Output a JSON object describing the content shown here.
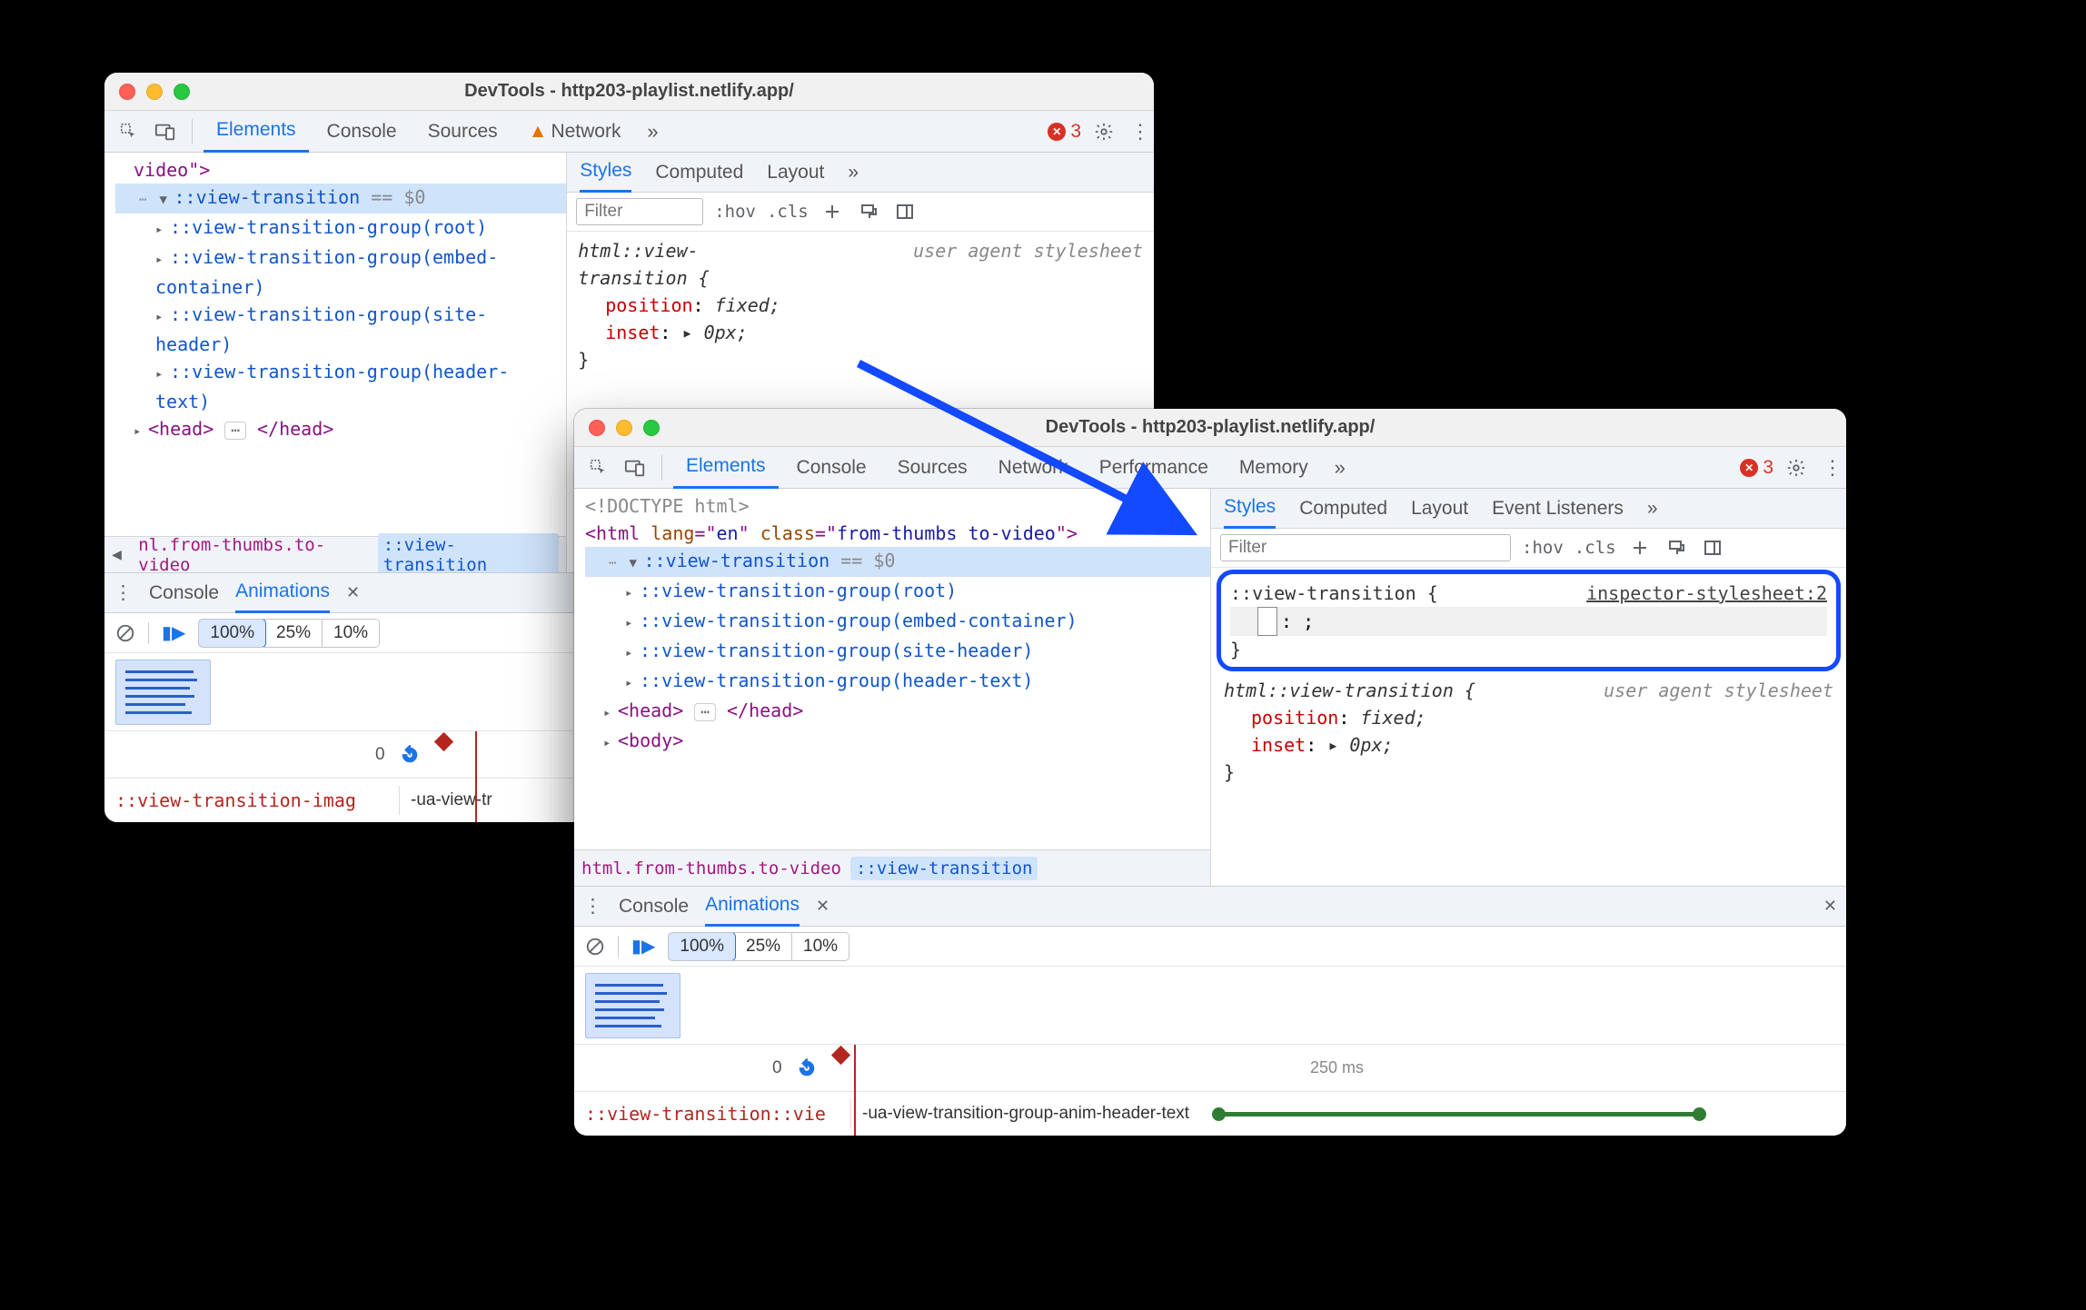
{
  "window1": {
    "title": "DevTools - http203-playlist.netlify.app/",
    "main_tabs": [
      "Elements",
      "Console",
      "Sources",
      "Network"
    ],
    "active_main_tab": "Elements",
    "warning_on": "Network",
    "error_count": "3",
    "dom": {
      "line0_prefix": "video\">",
      "selected": "::view-transition",
      "eqvar": "== $0",
      "groups": [
        "::view-transition-group(root)",
        "::view-transition-group(embed-container)",
        "::view-transition-group(site-header)",
        "::view-transition-group(header-text)"
      ],
      "head_open": "<head>",
      "head_close": "</head>"
    },
    "crumbs": {
      "left": "nl.from-thumbs.to-video",
      "selected": "::view-transition"
    },
    "styles": {
      "tabs": [
        "Styles",
        "Computed",
        "Layout"
      ],
      "active": "Styles",
      "filter_placeholder": "Filter",
      "hov": ":hov",
      "cls": ".cls",
      "rule_sel": "html::view-transition {",
      "ua": "user agent stylesheet",
      "p1_k": "position",
      "p1_v": "fixed;",
      "p2_k": "inset",
      "p2_v": "▸ 0px;",
      "close": "}"
    },
    "drawer": {
      "tabs": [
        "Console",
        "Animations"
      ],
      "active": "Animations",
      "speeds": [
        "100%",
        "25%",
        "10%"
      ],
      "active_speed": "100%",
      "zero": "0",
      "track_name": "::view-transition-imag",
      "anim": "-ua-view-tr"
    }
  },
  "window2": {
    "title": "DevTools - http203-playlist.netlify.app/",
    "main_tabs": [
      "Elements",
      "Console",
      "Sources",
      "Network",
      "Performance",
      "Memory"
    ],
    "active_main_tab": "Elements",
    "error_count": "3",
    "dom": {
      "doctype": "<!DOCTYPE html>",
      "html_open": "<html lang=\"en\" class=\"from-thumbs to-video\">",
      "selected": "::view-transition",
      "eqvar": "== $0",
      "groups": [
        "::view-transition-group(root)",
        "::view-transition-group(embed-container)",
        "::view-transition-group(site-header)",
        "::view-transition-group(header-text)"
      ],
      "head_open": "<head>",
      "head_close": "</head>",
      "body_open": "<body>"
    },
    "crumbs": {
      "left": "html.from-thumbs.to-video",
      "selected": "::view-transition"
    },
    "styles": {
      "tabs": [
        "Styles",
        "Computed",
        "Layout",
        "Event Listeners"
      ],
      "active": "Styles",
      "filter_placeholder": "Filter",
      "hov": ":hov",
      "cls": ".cls",
      "new_sel": "::view-transition {",
      "new_src": "inspector-stylesheet:2",
      "empty_rule": ":  ;",
      "close1": "}",
      "rule_sel": "html::view-transition {",
      "ua": "user agent stylesheet",
      "p1_k": "position",
      "p1_v": "fixed;",
      "p2_k": "inset",
      "p2_v": "▸ 0px;",
      "close2": "}"
    },
    "drawer": {
      "tabs": [
        "Console",
        "Animations"
      ],
      "active": "Animations",
      "speeds": [
        "100%",
        "25%",
        "10%"
      ],
      "active_speed": "100%",
      "zero": "0",
      "tick250": "250 ms",
      "track_name": "::view-transition::vie",
      "anim": "-ua-view-transition-group-anim-header-text"
    }
  }
}
